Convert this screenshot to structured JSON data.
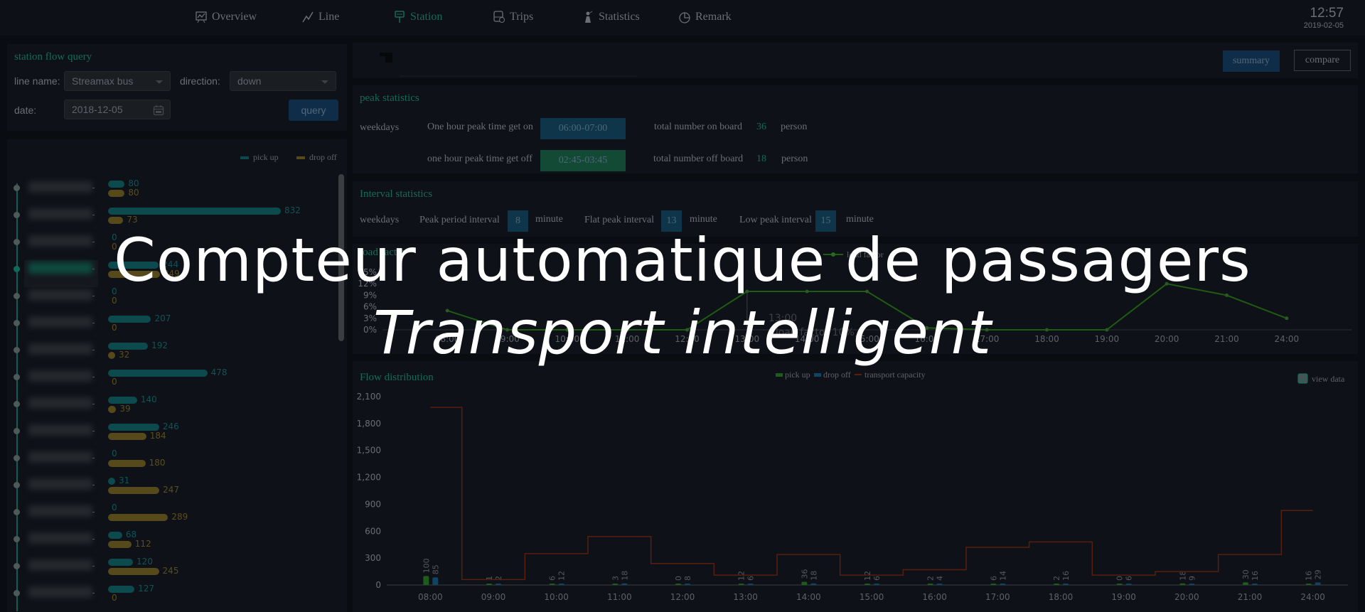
{
  "nav": {
    "items": [
      {
        "label": "Overview",
        "icon": "presentation-chart-icon",
        "active": false
      },
      {
        "label": "Line",
        "icon": "line-chart-icon",
        "active": false
      },
      {
        "label": "Station",
        "icon": "bus-stop-sign-icon",
        "active": true
      },
      {
        "label": "Trips",
        "icon": "bus-trips-icon",
        "active": false
      },
      {
        "label": "Statistics",
        "icon": "statistics-icon",
        "active": false
      },
      {
        "label": "Remark",
        "icon": "pie-chart-icon",
        "active": false
      }
    ],
    "time": "12:57",
    "date": "2019-02-05"
  },
  "query": {
    "title": "station flow query",
    "line_name_label": "line name:",
    "line_name_value": "Streamax bus",
    "direction_label": "direction:",
    "direction_value": "down",
    "date_label": "date:",
    "date_value": "2018-12-05",
    "query_button": "query"
  },
  "station_flow": {
    "legend": {
      "pick_up": "pick up",
      "drop_off": "drop off"
    },
    "colors": {
      "pick_up": "#0d4a4e",
      "drop_off": "#56491a"
    },
    "stations": [
      {
        "pick_up": 80,
        "drop_off": 80,
        "active": false
      },
      {
        "pick_up": 832,
        "drop_off": 73,
        "active": false
      },
      {
        "pick_up": 0,
        "drop_off": 0,
        "active": false
      },
      {
        "pick_up": 244,
        "drop_off": 249,
        "active": true
      },
      {
        "pick_up": 0,
        "drop_off": 0,
        "active": false
      },
      {
        "pick_up": 207,
        "drop_off": 0,
        "active": false
      },
      {
        "pick_up": 192,
        "drop_off": 32,
        "active": false
      },
      {
        "pick_up": 478,
        "drop_off": 0,
        "active": false
      },
      {
        "pick_up": 140,
        "drop_off": 39,
        "active": false
      },
      {
        "pick_up": 246,
        "drop_off": 184,
        "active": false
      },
      {
        "pick_up": 0,
        "drop_off": 180,
        "active": false
      },
      {
        "pick_up": 31,
        "drop_off": 247,
        "active": false
      },
      {
        "pick_up": 0,
        "drop_off": 289,
        "active": false
      },
      {
        "pick_up": 68,
        "drop_off": 112,
        "active": false
      },
      {
        "pick_up": 120,
        "drop_off": 245,
        "active": false
      },
      {
        "pick_up": 127,
        "drop_off": 0,
        "active": false
      }
    ]
  },
  "header_buttons": {
    "summary": "summary",
    "compare": "compare"
  },
  "peak": {
    "title": "peak statistics",
    "weekdays": "weekdays",
    "get_on_label": "One hour peak time get on",
    "get_on_value": "06:00-07:00",
    "get_off_label": "one hour peak time get off",
    "get_off_value": "02:45-03:45",
    "on_board_label": "total number on board",
    "on_board_value": "36",
    "off_board_label": "total number off board",
    "off_board_value": "18",
    "unit": "person"
  },
  "interval": {
    "title": "Interval statistics",
    "weekdays": "weekdays",
    "peak_label": "Peak period interval",
    "peak_value": "8",
    "flat_label": "Flat peak interval",
    "flat_value": "13",
    "low_label": "Low peak interval",
    "low_value": "15",
    "unit": "minute"
  },
  "overlay": {
    "line1": "Compteur automatique de passagers",
    "line2": "Transport intelligent"
  },
  "chart_data": [
    {
      "type": "line",
      "title": "load factor",
      "legend": [
        "load factor"
      ],
      "legend_position": "top-right",
      "categories": [
        "08:00",
        "09:00",
        "10:00",
        "11:00",
        "12:00",
        "13:00",
        "14:00",
        "15:00",
        "16:00",
        "17:00",
        "18:00",
        "19:00",
        "20:00",
        "21:00",
        "24:00"
      ],
      "series": [
        {
          "name": "load factor",
          "values": [
            5,
            0,
            0,
            0,
            0,
            10,
            10,
            10,
            0.5,
            0,
            0,
            0,
            12,
            9,
            3
          ]
        }
      ],
      "yticks": [
        "0%",
        "3%",
        "6%",
        "9%",
        "12%",
        "15%"
      ],
      "ylim": [
        0,
        15
      ],
      "tooltip": {
        "category": "13:00",
        "label": "load factor",
        "value": "10%"
      },
      "color": "#1e5c12"
    },
    {
      "type": "bar",
      "title": "Flow distribution",
      "legend": [
        "pick up",
        "drop off",
        "transport capacity"
      ],
      "legend_position": "top-center",
      "view_data_label": "view data",
      "view_data_checked": true,
      "categories": [
        "08:00",
        "09:00",
        "10:00",
        "11:00",
        "12:00",
        "13:00",
        "14:00",
        "15:00",
        "16:00",
        "17:00",
        "18:00",
        "19:00",
        "20:00",
        "21:00",
        "24:00"
      ],
      "series": [
        {
          "name": "pick up",
          "values": [
            100,
            1,
            6,
            3,
            0,
            12,
            36,
            12,
            2,
            6,
            2,
            0,
            18,
            30,
            16
          ],
          "color": "#1e5c1c"
        },
        {
          "name": "drop off",
          "values": [
            85,
            2,
            12,
            18,
            8,
            6,
            18,
            6,
            4,
            14,
            16,
            6,
            9,
            16,
            29
          ],
          "color": "#0e4563"
        },
        {
          "name": "transport capacity",
          "values": [
            1980,
            60,
            350,
            540,
            240,
            110,
            340,
            110,
            170,
            420,
            480,
            110,
            150,
            340,
            830
          ],
          "color": "#5a1e0c",
          "style": "step"
        }
      ],
      "yticks": [
        "0",
        "300",
        "600",
        "900",
        "1,200",
        "1,500",
        "1,800",
        "2,100"
      ],
      "ylim": [
        0,
        2100
      ]
    }
  ]
}
